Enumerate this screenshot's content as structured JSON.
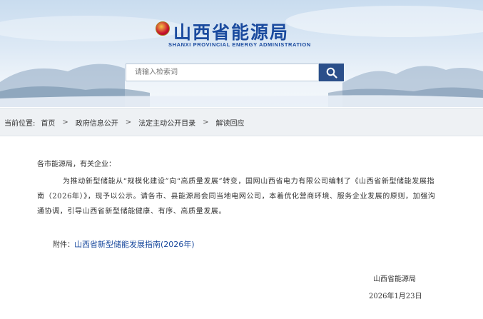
{
  "header": {
    "title": "山西省能源局",
    "subtitle": "SHANXI PROVINCIAL ENERGY ADMINISTRATION",
    "emblem_icon": "emblem-icon"
  },
  "search": {
    "placeholder": "请输入检索词",
    "button_icon": "search-icon"
  },
  "breadcrumb": {
    "prefix": "当前位置:",
    "items": [
      "首页",
      "政府信息公开",
      "法定主动公开目录",
      "解读回应"
    ],
    "separator": ">"
  },
  "article": {
    "salutation": "各市能源局，有关企业：",
    "body": "为推动新型储能从“规模化建设”向“高质量发展”转变，国网山西省电力有限公司编制了《山西省新型储能发展指南（2026年）》，现予以公示。请各市、县能源局会同当地电网公司，本着优化营商环境、服务企业发展的原则，加强沟通协调，引导山西省新型储能健康、有序、高质量发展。",
    "attachment_label": "附件：",
    "attachment_link": "山西省新型储能发展指南(2026年)",
    "sign_org": "山西省能源局",
    "sign_date": "2026年1月23日"
  },
  "colors": {
    "brand_blue": "#1a4a9e",
    "search_button": "#2b4f8a",
    "crumb_bg": "#eef1f4"
  }
}
